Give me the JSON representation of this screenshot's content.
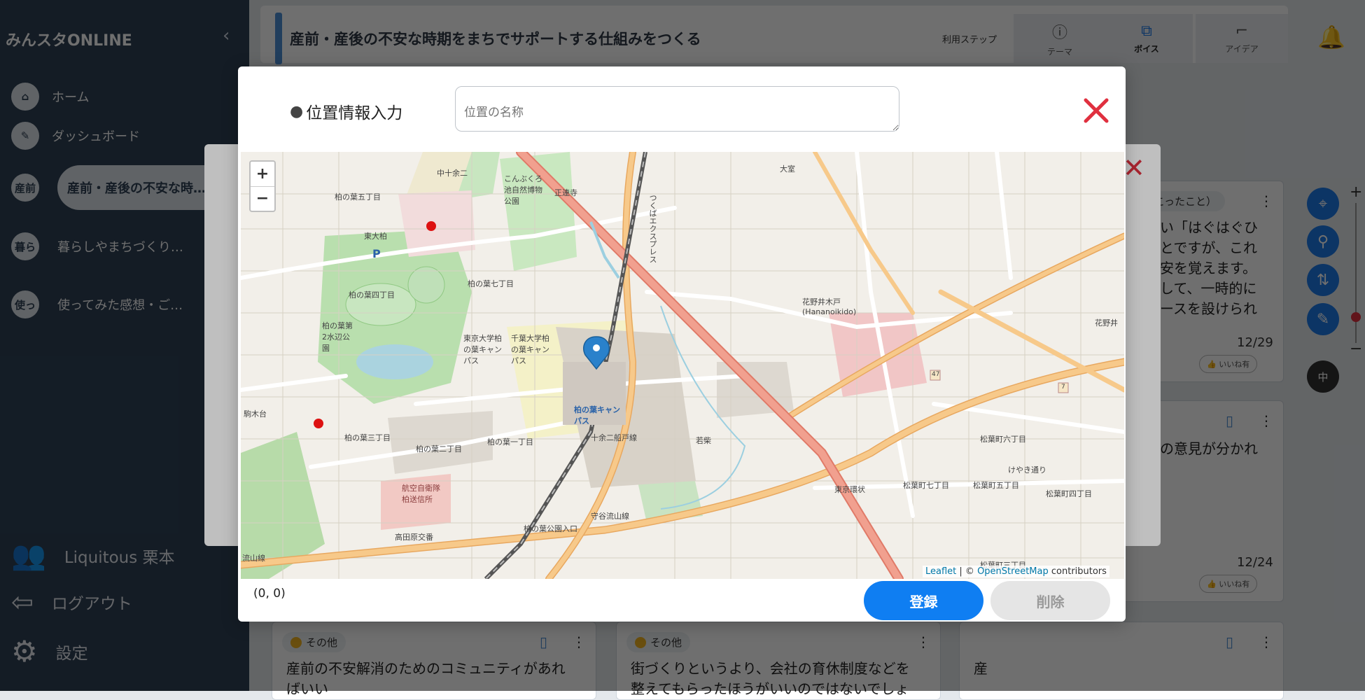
{
  "sidebar": {
    "brand": "みんスタONLINE",
    "collapse_icon": "chevron-left-icon",
    "nav": [
      {
        "label": "ホーム",
        "icon": "home-icon"
      },
      {
        "label": "ダッシュボード",
        "icon": "pin-icon"
      }
    ],
    "groups": [
      {
        "badge": "産前",
        "label": "産前・産後の不安な時…"
      },
      {
        "badge": "暮ら",
        "label": "暮らしやまちづくり…"
      },
      {
        "badge": "使っ",
        "label": "使ってみた感想・ご…"
      }
    ],
    "footer": {
      "user": "Liquitous 栗本",
      "logout": "ログアウト",
      "settings": "設定"
    }
  },
  "header": {
    "title": "産前・産後の不安な時期をまちでサポートする仕組みをつくる",
    "steps_label": "利用ステップ",
    "steps": [
      {
        "label": "テーマ",
        "icon": "info-icon"
      },
      {
        "label": "ボイス",
        "icon": "voice-icon"
      },
      {
        "label": "アイデア",
        "icon": "idea-icon"
      }
    ]
  },
  "tools": {
    "size_label": "中"
  },
  "background_cards": {
    "card1_tag": "こったこと）",
    "card1_lines": [
      "い「はぐはぐひ",
      "とですが、これ",
      "安を覚えます。",
      "して、一時的に",
      "ースを設けられ"
    ],
    "card1_date": "12/29",
    "card2_line": "の意見が分かれ",
    "card2_date": "12/24",
    "like_label": "いいね有",
    "bottom_cards": [
      {
        "tag": "その他",
        "text": "産前の不安解消のためのコミュニティがあれ",
        "text2": "ばいい"
      },
      {
        "tag": "その他",
        "text": "街づくりというより、会社の育休制度などを",
        "text2": "整えてもらったほうがいいのではないでしょ"
      },
      {
        "tag": "",
        "text": "産",
        "text2": ""
      }
    ]
  },
  "modal": {
    "title": "位置情報入力",
    "input_placeholder": "位置の名称",
    "coords": "(0, 0)",
    "register_label": "登録",
    "delete_label": "削除",
    "zoom_in": "+",
    "zoom_out": "−",
    "attribution_leaflet": "Leaflet",
    "attribution_sep": "| ©",
    "attribution_osm": "OpenStreetMap",
    "attribution_tail": "contributors"
  },
  "map_labels": [
    "中十余二",
    "こんぶくろ池自然博物公園",
    "正連寺",
    "大室",
    "柏の葉五丁目",
    "東大柏",
    "柏の葉四丁目",
    "柏の葉第2水辺公園",
    "柏の葉七丁目",
    "東京大学柏の葉キャンパス",
    "千葉大学柏の葉キャンパス",
    "柏の葉キャンパス",
    "十余二船戸線",
    "若柴",
    "駒木台",
    "柏の葉三丁目",
    "柏の葉二丁目",
    "柏の葉一丁目",
    "航空自衛隊柏送信所",
    "高田原交番",
    "柏の葉公園入口",
    "守谷流山線",
    "流山線",
    "東京環状",
    "花野井木戸 (Hananoikido)",
    "花野井",
    "松葉町六丁目",
    "松葉町七丁目",
    "松葉町五丁目",
    "松葉町四丁目",
    "けやき通り",
    "松葉町三丁目",
    "つくばエクスプレス",
    "47",
    "7"
  ]
}
